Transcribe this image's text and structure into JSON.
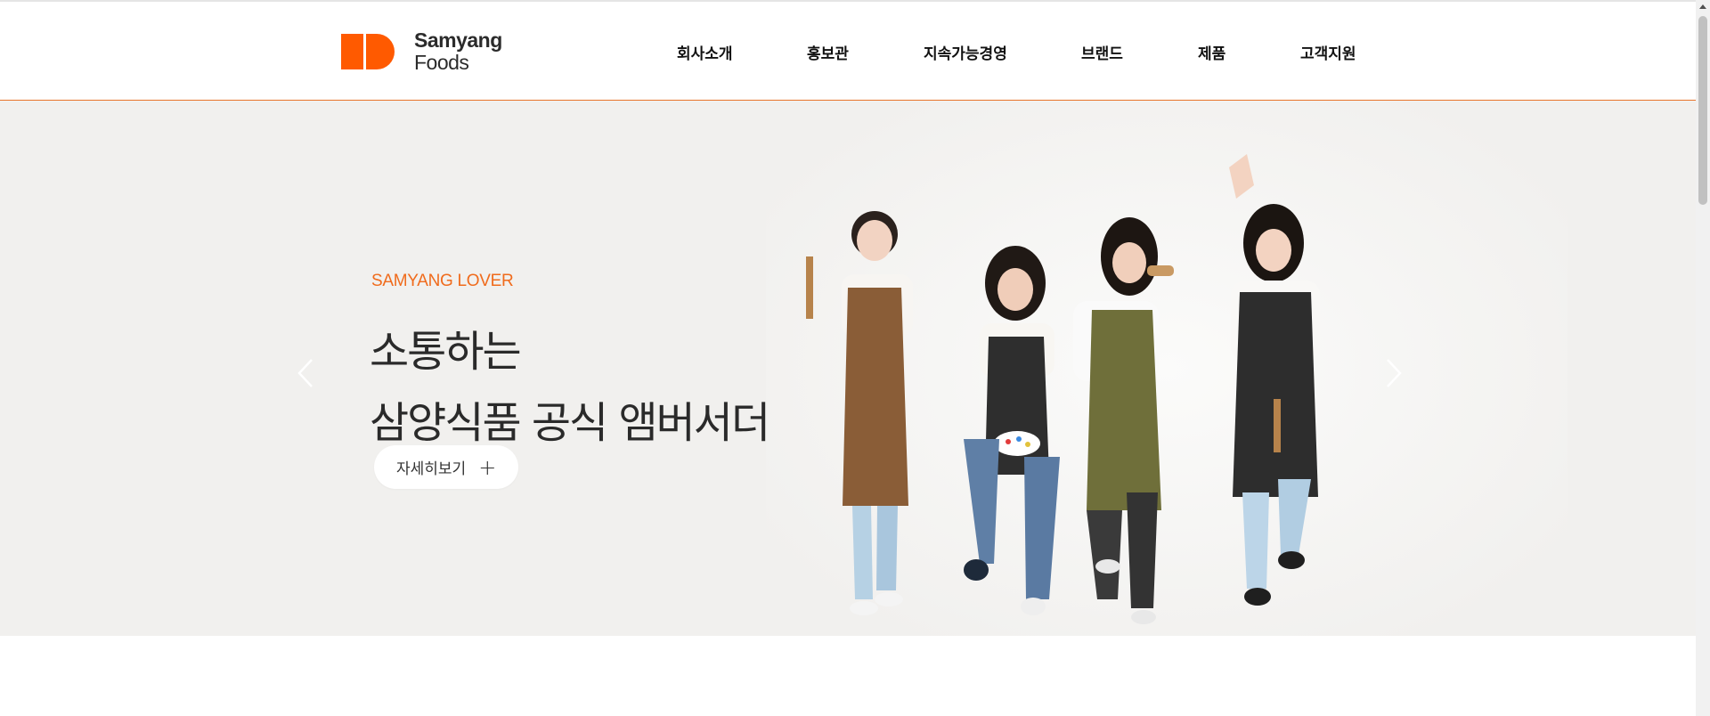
{
  "brand": {
    "line1": "Samyang",
    "line2": "Foods",
    "accent": "#ff5a00"
  },
  "nav": {
    "items": [
      {
        "label": "회사소개"
      },
      {
        "label": "홍보관"
      },
      {
        "label": "지속가능경영"
      },
      {
        "label": "브랜드"
      },
      {
        "label": "제품"
      },
      {
        "label": "고객지원"
      }
    ]
  },
  "hero": {
    "eyebrow": "SAMYANG LOVER",
    "headline_line1": "소통하는",
    "headline_line2": "삼양식품 공식 앰버서더",
    "button_label": "자세히보기",
    "button_icon": "plus-icon",
    "prev_icon": "chevron-left-icon",
    "next_icon": "chevron-right-icon",
    "eyebrow_color": "#f06b1c"
  }
}
